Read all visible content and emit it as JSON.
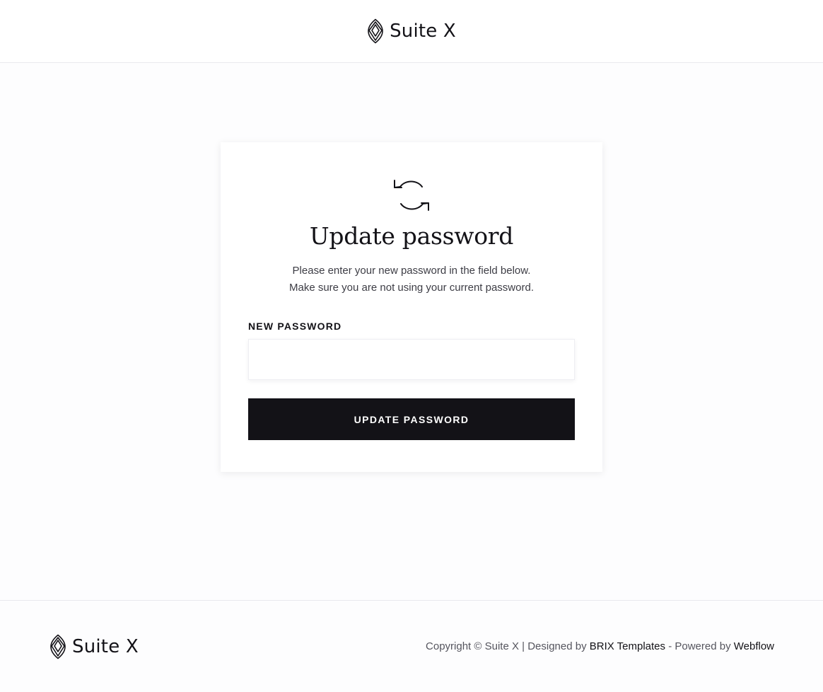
{
  "header": {
    "brand_name": "Suite X",
    "logo_icon": "leaf-logo-icon"
  },
  "card": {
    "icon": "refresh-icon",
    "title": "Update password",
    "description_line1": "Please enter your new password in the field below.",
    "description_line2": "Make sure you are not using your current password.",
    "field_label": "NEW PASSWORD",
    "field_value": "",
    "button_label": "UPDATE PASSWORD"
  },
  "footer": {
    "brand_name": "Suite X",
    "copyright_prefix": "Copyright © Suite X  | Designed by ",
    "designer_link": "BRIX Templates",
    "powered_text": " - Powered by ",
    "platform_link": "Webflow"
  },
  "colors": {
    "primary": "#131217",
    "text_muted": "#55555e",
    "background": "#fdfdfe",
    "card_background": "#ffffff",
    "border": "#e9e9ee"
  }
}
